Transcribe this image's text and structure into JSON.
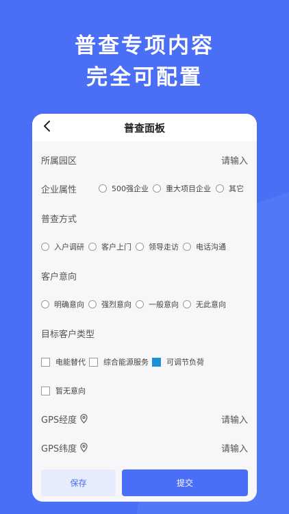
{
  "headline": {
    "line1": "普查专项内容",
    "line2": "完全可配置"
  },
  "navbar": {
    "title": "普查面板",
    "back_icon": "chevron-left-icon"
  },
  "form": {
    "park": {
      "label": "所属园区",
      "placeholder": "请输入"
    },
    "enterprise_attr": {
      "label": "企业属性",
      "options": [
        "500强企业",
        "重大项目企业",
        "其它"
      ]
    },
    "survey_method": {
      "label": "普查方式",
      "options": [
        "入户调研",
        "客户上门",
        "领导走访",
        "电话沟通"
      ]
    },
    "customer_intent": {
      "label": "客户意向",
      "options": [
        "明确意向",
        "强烈意向",
        "一般意向",
        "无此意向"
      ]
    },
    "target_type": {
      "label": "目标客户类型",
      "options": [
        "电能替代",
        "综合能源服务",
        "可调节负荷",
        "暂无意向"
      ],
      "checked": "可调节负荷"
    },
    "gps_lng": {
      "label": "GPS经度",
      "placeholder": "请输入",
      "icon": "location-pin-icon"
    },
    "gps_lat": {
      "label": "GPS纬度",
      "placeholder": "请输入",
      "icon": "location-pin-icon"
    }
  },
  "actions": {
    "save": "保存",
    "submit": "提交"
  },
  "colors": {
    "primary": "#4a6ef5",
    "checked": "#1e90d8",
    "save_bg": "#e6ecfb"
  }
}
